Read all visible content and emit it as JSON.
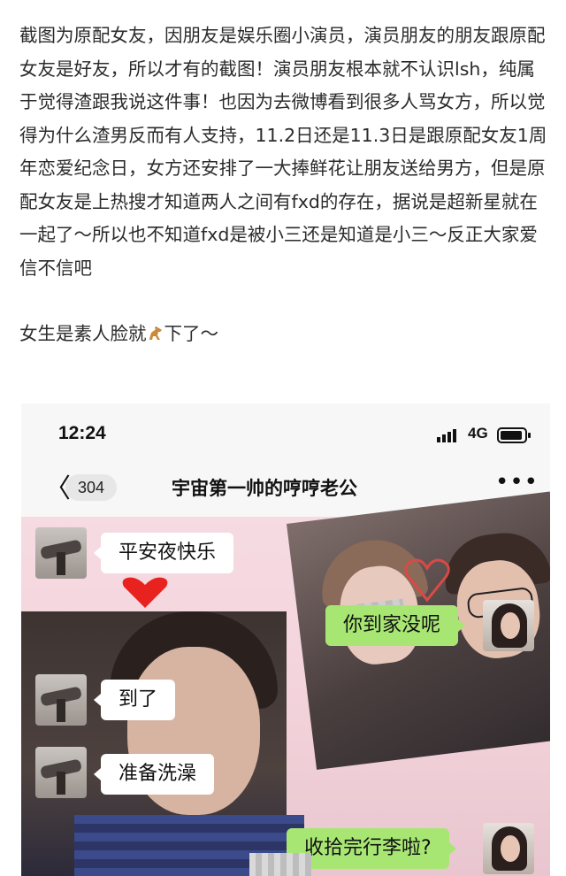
{
  "post": {
    "paragraph1": "截图为原配女友，因朋友是娱乐圈小演员，演员朋友的朋友跟原配女友是好友，所以才有的截图！演员朋友根本就不认识lsh，纯属于觉得渣跟我说这件事！也因为去微博看到很多人骂女方，所以觉得为什么渣男反而有人支持，11.2日还是11.3日是跟原配女友1周年恋爱纪念日，女方还安排了一大捧鲜花让朋友送给男方，但是原配女友是上热搜才知道两人之间有fxd的存在，据说是超新星就在一起了～所以也不知道fxd是被小三还是知道是小三～反正大家爱信不信吧",
    "paragraph2_before": "女生是素人脸就",
    "paragraph2_after": "下了～"
  },
  "phone": {
    "time": "12:24",
    "network": "4G",
    "unread_count": "304",
    "chat_title": "宇宙第一帅的哼哼老公",
    "more_label": "•••",
    "back_glyph": "〈"
  },
  "messages": [
    {
      "side": "in",
      "text": "平安夜快乐"
    },
    {
      "side": "out",
      "text": "你到家没呢"
    },
    {
      "side": "in",
      "text": "到了"
    },
    {
      "side": "in",
      "text": "准备洗澡"
    },
    {
      "side": "out",
      "text": "收拾完行李啦?"
    }
  ],
  "colors": {
    "chat_bg": "#f6dbe2",
    "out_bubble": "#a8e674",
    "in_bubble": "#ffffff",
    "heart_red": "#e8231f",
    "heart_outline": "#d94a46"
  },
  "icons": [
    "chevron-left-icon",
    "signal-icon",
    "battery-icon",
    "more-icon",
    "heart-icon",
    "horse-emoji-icon"
  ]
}
